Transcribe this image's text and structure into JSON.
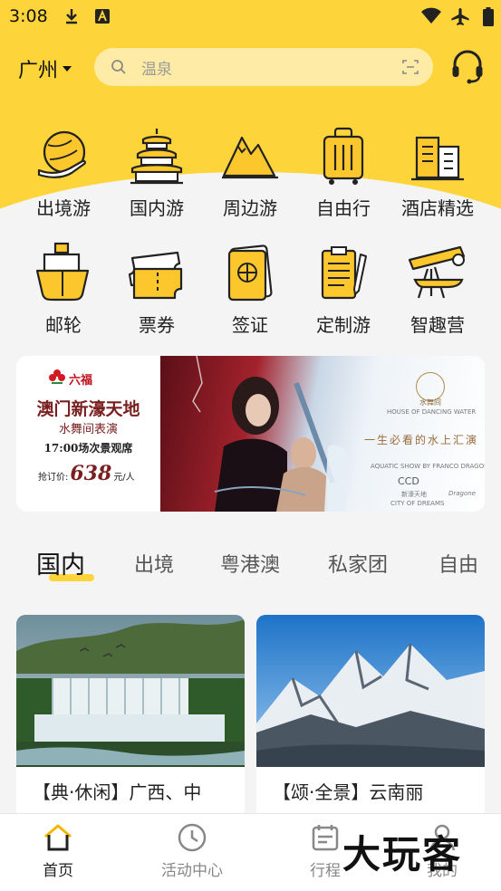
{
  "status_bar": {
    "time": "3:08"
  },
  "header": {
    "city": "广州",
    "search_placeholder": "温泉"
  },
  "menu_row1": [
    {
      "label": "出境游",
      "icon": "globe-hand-icon"
    },
    {
      "label": "国内游",
      "icon": "temple-icon"
    },
    {
      "label": "周边游",
      "icon": "mountain-icon"
    },
    {
      "label": "自由行",
      "icon": "luggage-icon"
    },
    {
      "label": "酒店精选",
      "icon": "hotel-icon"
    }
  ],
  "menu_row2": [
    {
      "label": "邮轮",
      "icon": "cruise-ship-icon"
    },
    {
      "label": "票券",
      "icon": "ticket-icon"
    },
    {
      "label": "签证",
      "icon": "passport-icon"
    },
    {
      "label": "定制游",
      "icon": "clipboard-pen-icon"
    },
    {
      "label": "智趣营",
      "icon": "telescope-icon"
    }
  ],
  "banner": {
    "brand": "六福",
    "title": "澳门新濠天地",
    "subtitle": "水舞间表演",
    "time": "17:00场次景观席",
    "price_label": "抢订价:",
    "price": "638",
    "price_unit": "元/人",
    "slogan": "一生必看的水上汇演",
    "emblem": "水舞间",
    "emblem_sub": "HOUSE OF DANCING WATER",
    "ccd": "CCD",
    "city_of_dreams": "新濠天地",
    "city_of_dreams_en": "CITY OF DREAMS",
    "aquatic_credit": "AQUATIC SHOW BY FRANCO DRAGONE",
    "dragone": "Dragone"
  },
  "tabs": [
    "国内",
    "出境",
    "粤港澳",
    "私家团",
    "自由"
  ],
  "cards": [
    {
      "title": "【典·休闲】广西、中"
    },
    {
      "title": "【颂·全景】云南丽"
    }
  ],
  "bottom_nav": [
    {
      "label": "首页",
      "icon": "home-icon",
      "active": true
    },
    {
      "label": "活动中心",
      "icon": "clock-icon",
      "active": false
    },
    {
      "label": "行程",
      "icon": "calendar-icon",
      "active": false
    },
    {
      "label": "我的",
      "icon": "user-icon",
      "active": false
    }
  ],
  "watermark": "大玩客",
  "colors": {
    "brand_yellow": "#fdd43a",
    "icon_yellow": "#fcc72c",
    "icon_stroke": "#222222"
  }
}
